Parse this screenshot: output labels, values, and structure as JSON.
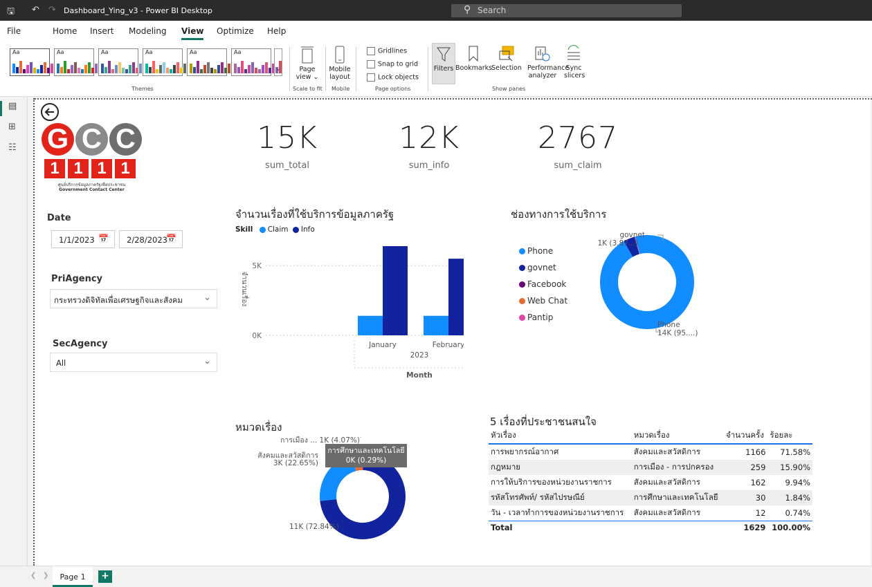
{
  "window": {
    "title": "Dashboard_Ying_v3 - Power BI Desktop",
    "search_placeholder": "Search"
  },
  "menu": [
    "File",
    "Home",
    "Insert",
    "Modeling",
    "View",
    "Optimize",
    "Help"
  ],
  "menu_active": "View",
  "ribbon": {
    "themes_label": "Themes",
    "theme_aa": "Aa",
    "page_view": "Page view",
    "scale_to_fit": "Scale to fit",
    "mobile_layout": "Mobile layout",
    "mobile": "Mobile",
    "gridlines": "Gridlines",
    "snap_to_grid": "Snap to grid",
    "lock_objects": "Lock objects",
    "page_options": "Page options",
    "filters": "Filters",
    "bookmarks": "Bookmarks",
    "selection": "Selection",
    "performance_analyzer": "Performance analyzer",
    "sync_slicers": "Sync slicers",
    "show_panes": "Show panes"
  },
  "logo": {
    "letters": "GCC",
    "numbers": "1111",
    "thai_text": "ศูนย์บริการข้อมูลภาครัฐเพื่อประชาชน",
    "english_text": "Government Contact Center"
  },
  "kpis": [
    {
      "value": "15K",
      "label": "sum_total"
    },
    {
      "value": "12K",
      "label": "sum_info"
    },
    {
      "value": "2767",
      "label": "sum_claim"
    }
  ],
  "slicers": {
    "date_title": "Date",
    "date_from": "1/1/2023",
    "date_to": "2/28/2023",
    "pri_title": "PriAgency",
    "pri_value": "กระทรวงดิจิทัลเพื่อเศรษฐกิจและสังคม",
    "sec_title": "SecAgency",
    "sec_value": "All"
  },
  "bar_chart": {
    "title": "จำนวนเรื่องที่ใช้บริการข้อมูลภาครัฐ",
    "legend_title": "Skill",
    "series_names": [
      "Claim",
      "Info"
    ],
    "colors": {
      "Claim": "#118dff",
      "Info": "#12239e"
    },
    "ylabel": "จำนวนเรื่อง",
    "yticks": [
      "5K",
      "0K"
    ],
    "year_label": "2023",
    "xlabel": "Month"
  },
  "channel_chart": {
    "title": "ช่องทางการใช้บริการ",
    "legend": [
      {
        "name": "Phone",
        "color": "#118dff"
      },
      {
        "name": "govnet",
        "color": "#12239e"
      },
      {
        "name": "Facebook",
        "color": "#6b007b"
      },
      {
        "name": "Web Chat",
        "color": "#e66c37"
      },
      {
        "name": "Pantip",
        "color": "#e044a7"
      }
    ],
    "label_govnet_name": "govnet",
    "label_govnet_val": "1K (3.87...)",
    "label_phone_name": "Phone",
    "label_phone_val": "14K (95....)"
  },
  "category_chart": {
    "title": "หมวดเรื่อง",
    "label_politics": "การเมือง ... 1K (4.07%)",
    "label_social_name": "สังคมและสวัสดิการ",
    "label_social_val": "3K (22.65%)",
    "label_main": "11K (72.84%)",
    "tooltip_name": "การศึกษาและเทคโนโลยี",
    "tooltip_val": "0K (0.29%)"
  },
  "top5": {
    "title": "5 เรื่องที่ประชาชนสนใจ",
    "headers": [
      "หัวเรื่อง",
      "หมวดเรื่อง",
      "จำนวนครั้ง",
      "ร้อยละ"
    ],
    "rows": [
      [
        "การพยากรณ์อากาศ",
        "สังคมและสวัสดิการ",
        "1166",
        "71.58%"
      ],
      [
        "กฎหมาย",
        "การเมือง - การปกครอง",
        "259",
        "15.90%"
      ],
      [
        "การให้บริการของหน่วยงานราชการ",
        "สังคมและสวัสดิการ",
        "162",
        "9.94%"
      ],
      [
        "รหัสโทรศัพท์/ รหัสไปรษณีย์",
        "การศึกษาและเทคโนโลยี",
        "30",
        "1.84%"
      ],
      [
        "วัน - เวลาทำการของหน่วยงานราชการ",
        "สังคมและสวัสดิการ",
        "12",
        "0.74%"
      ]
    ],
    "total": [
      "Total",
      "",
      "1629",
      "100.00%"
    ]
  },
  "status": {
    "page_tab": "Page 1",
    "add": "+"
  },
  "chart_data": [
    {
      "type": "bar",
      "title": "จำนวนเรื่องที่ใช้บริการข้อมูลภาครัฐ",
      "categories": [
        "January",
        "February"
      ],
      "series": [
        {
          "name": "Claim",
          "values": [
            1400,
            1400
          ]
        },
        {
          "name": "Info",
          "values": [
            6400,
            5500
          ]
        }
      ],
      "ylabel": "จำนวนเรื่อง",
      "xlabel": "Month",
      "ylim": [
        0,
        6600
      ]
    },
    {
      "type": "pie",
      "title": "ช่องทางการใช้บริการ",
      "labels": [
        "Phone",
        "govnet",
        "Facebook",
        "Web Chat",
        "Pantip"
      ],
      "values": [
        95.9,
        3.87,
        0.1,
        0.08,
        0.05
      ]
    },
    {
      "type": "pie",
      "title": "หมวดเรื่อง",
      "labels": [
        "สังคมและสวัสดิการ",
        "การเมือง - การปกครอง",
        "การศึกษาและเทคโนโลยี",
        ""
      ],
      "values": [
        22.65,
        4.07,
        0.29,
        72.84
      ]
    }
  ]
}
